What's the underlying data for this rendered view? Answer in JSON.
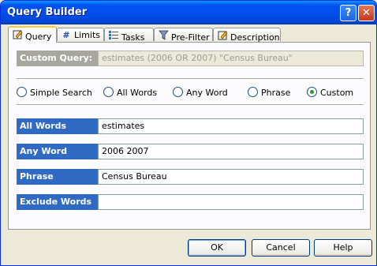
{
  "window": {
    "title": "Query Builder",
    "help_glyph": "?",
    "close_glyph": "✕"
  },
  "tabs": [
    {
      "label": "Query",
      "icon": "pencil-icon"
    },
    {
      "label": "Limits",
      "icon": "hash-icon",
      "glyph": "#"
    },
    {
      "label": "Tasks",
      "icon": "tasks-icon"
    },
    {
      "label": "Pre-Filter",
      "icon": "funnel-icon"
    },
    {
      "label": "Description",
      "icon": "notepad-icon"
    }
  ],
  "custom_query": {
    "label": "Custom Query:",
    "value": "estimates (2006 OR 2007) \"Census Bureau\""
  },
  "search_modes": [
    {
      "label": "Simple Search",
      "selected": false
    },
    {
      "label": "All Words",
      "selected": false
    },
    {
      "label": "Any Word",
      "selected": false
    },
    {
      "label": "Phrase",
      "selected": false
    },
    {
      "label": "Custom",
      "selected": true
    }
  ],
  "fields": [
    {
      "label": "All Words",
      "value": "estimates"
    },
    {
      "label": "Any Word",
      "value": "2006 2007"
    },
    {
      "label": "Phrase",
      "value": "Census Bureau"
    },
    {
      "label": "Exclude Words",
      "value": ""
    }
  ],
  "buttons": {
    "ok": "OK",
    "cancel": "Cancel",
    "help": "Help"
  },
  "colors": {
    "label_blue": "#316AC5",
    "label_disabled": "#A7A69F",
    "titlebar": "#0050EE",
    "active_tab_accent": "#FFC83C",
    "radio_dot": "#21A121"
  }
}
